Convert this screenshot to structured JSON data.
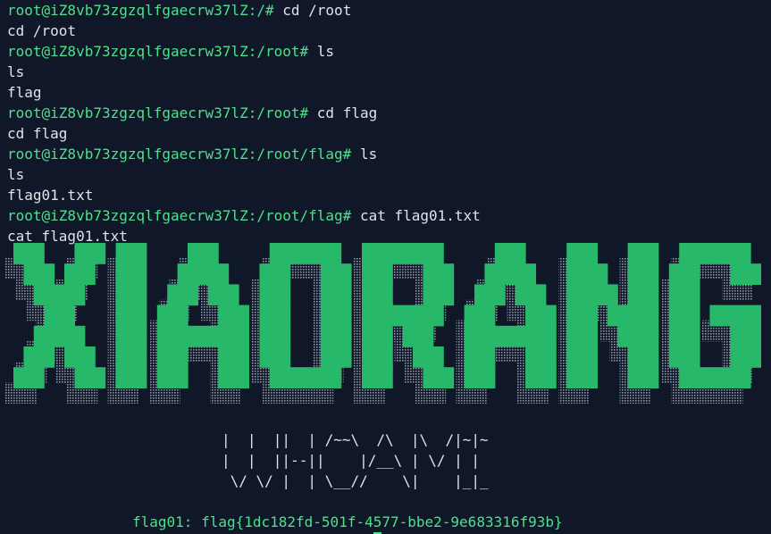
{
  "terminal": {
    "prompt_color": "#4ee08a",
    "text_color": "#dfe4ea",
    "background": "#0f1729",
    "lines": [
      {
        "prompt": "root@iZ8vb73zgzqlfgaecrw37lZ:/#",
        "command": " cd /root"
      },
      {
        "prompt": "",
        "command": "cd /root"
      },
      {
        "prompt": "root@iZ8vb73zgzqlfgaecrw37lZ:/root#",
        "command": " ls"
      },
      {
        "prompt": "",
        "command": "ls"
      },
      {
        "prompt": "",
        "command": "flag"
      },
      {
        "prompt": "root@iZ8vb73zgzqlfgaecrw37lZ:/root#",
        "command": " cd flag"
      },
      {
        "prompt": "",
        "command": "cd flag"
      },
      {
        "prompt": "root@iZ8vb73zgzqlfgaecrw37lZ:/root/flag#",
        "command": " ls"
      },
      {
        "prompt": "",
        "command": "ls"
      },
      {
        "prompt": "",
        "command": "flag01.txt"
      },
      {
        "prompt": "root@iZ8vb73zgzqlfgaecrw37lZ:/root/flag#",
        "command": " cat flag01.txt"
      },
      {
        "prompt": "",
        "command": "cat flag01.txt"
      }
    ]
  },
  "banner": {
    "text": "XIAORANG",
    "color": "#27b86a",
    "shadow_color": "#8c95a3"
  },
  "subtitle_ascii": [
    "|  |  ||  | /~~\\  /\\  |\\  /|~|~",
    "|  |  ||--||    |/__\\ | \\/ | |",
    " \\/ \\/ |  | \\__//    \\|    |_|_"
  ],
  "flag_line": "flag01: flag{1dc182fd-501f-4577-bbe2-9e683316f93b}"
}
